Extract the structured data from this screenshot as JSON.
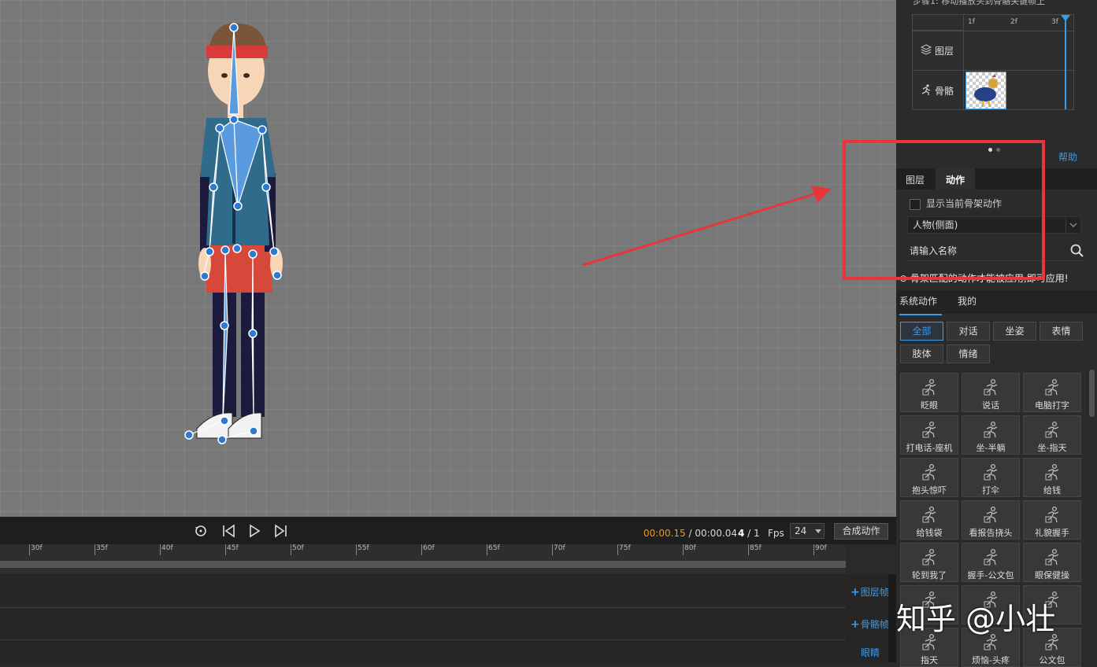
{
  "timeline": {
    "time_current": "00:00.15",
    "time_sep": " / ",
    "time_total": "00:00.04",
    "frame_current": "4",
    "frame_total": " / 1",
    "fps_label": "Fps",
    "fps_value": "24",
    "compose_button": "合成动作",
    "ruler_ticks": [
      "30f",
      "35f",
      "40f",
      "45f",
      "50f",
      "55f",
      "60f",
      "65f",
      "70f",
      "75f",
      "80f",
      "85f",
      "90f"
    ],
    "add_layer_frame": "图层帧",
    "add_bone_frame": "骨骼帧",
    "track_label": "眼睛"
  },
  "step_panel": {
    "step_text": "步骤1: 移动播放头到骨骼关键帧上",
    "frames": [
      "1f",
      "2f",
      "3f"
    ],
    "rows": [
      {
        "label": "图层",
        "icon": "layers-icon"
      },
      {
        "label": "骨骼",
        "icon": "running-icon"
      }
    ],
    "help": "帮助"
  },
  "panel": {
    "tabs": [
      "图层",
      "动作"
    ],
    "active_tab": "动作",
    "checkbox_label": "显示当前骨架动作",
    "select_value": "人物(侧面)",
    "search_placeholder": "请输入名称",
    "notice": "骨架匹配的动作才能被应用,即可应用!",
    "subtabs": [
      "系统动作",
      "我的"
    ],
    "categories": [
      "全部",
      "对话",
      "坐姿",
      "表情",
      "肢体",
      "情绪"
    ],
    "actions": [
      "眨眼",
      "说话",
      "电脑打字",
      "打电话-座机",
      "坐-半躺",
      "坐-指天",
      "抱头惊吓",
      "打伞",
      "给钱",
      "给钱袋",
      "看报告挠头",
      "礼貌握手",
      "轮到我了",
      "握手-公文包",
      "眼保健操",
      "",
      "",
      "",
      "指天",
      "烦恼-头疼",
      "公文包"
    ]
  },
  "watermark": "知乎 @小壮",
  "colors": {
    "accent": "#3d9be9",
    "highlight": "#e8353b",
    "time": "#e39b27"
  }
}
